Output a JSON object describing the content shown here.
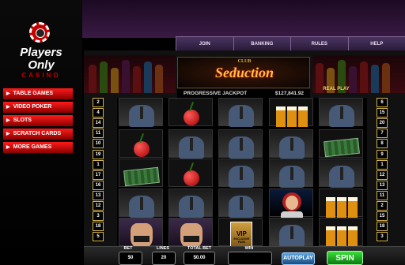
{
  "logo": {
    "line1": "Players",
    "line2": "Only",
    "line3": "CASINO"
  },
  "menu": [
    {
      "label": "TABLE GAMES"
    },
    {
      "label": "VIDEO POKER"
    },
    {
      "label": "SLOTS"
    },
    {
      "label": "SCRATCH CARDS"
    },
    {
      "label": "MORE GAMES"
    }
  ],
  "nav": [
    {
      "label": "JOIN"
    },
    {
      "label": "BANKING"
    },
    {
      "label": "RULES"
    },
    {
      "label": "HELP"
    }
  ],
  "game": {
    "title_small": "CLUB",
    "title_big": "Seduction",
    "jackpot_label": "PROGRESSIVE JACKPOT",
    "jackpot_value": "$127,841.92",
    "mode": "REAL PLAY"
  },
  "paylines_left": [
    "2",
    "4",
    "14",
    "11",
    "10",
    "19",
    "1",
    "17",
    "16",
    "13",
    "12",
    "3",
    "18",
    "5"
  ],
  "paylines_right": [
    "6",
    "15",
    "20",
    "7",
    "8",
    "9",
    "1",
    "12",
    "13",
    "11",
    "2",
    "15",
    "18",
    "3"
  ],
  "reels": [
    [
      "cheers",
      "cherry",
      "cash",
      "cheers",
      "dancer"
    ],
    [
      "cherry",
      "cheers",
      "cherry",
      "cheers",
      "dancer"
    ],
    [
      "cheers",
      "cheers",
      "cheers",
      "cheers",
      "vip"
    ],
    [
      "beer",
      "cheers",
      "cheers",
      "woman",
      "cheers"
    ],
    [
      "cheers",
      "cash",
      "cheers",
      "beer",
      "beer"
    ]
  ],
  "vip": {
    "label": "VIP",
    "sub": "EXCLUSIVE PASS"
  },
  "bottom": {
    "bet_label": "BET",
    "lines_label": "LINES",
    "total_bet_label": "TOTAL BET",
    "win_label": "WIN",
    "autoplay": "AUTOPLAY",
    "spin": "SPIN",
    "bet_value": "$0",
    "lines_value": "20",
    "total_bet_value": "$0.00"
  }
}
